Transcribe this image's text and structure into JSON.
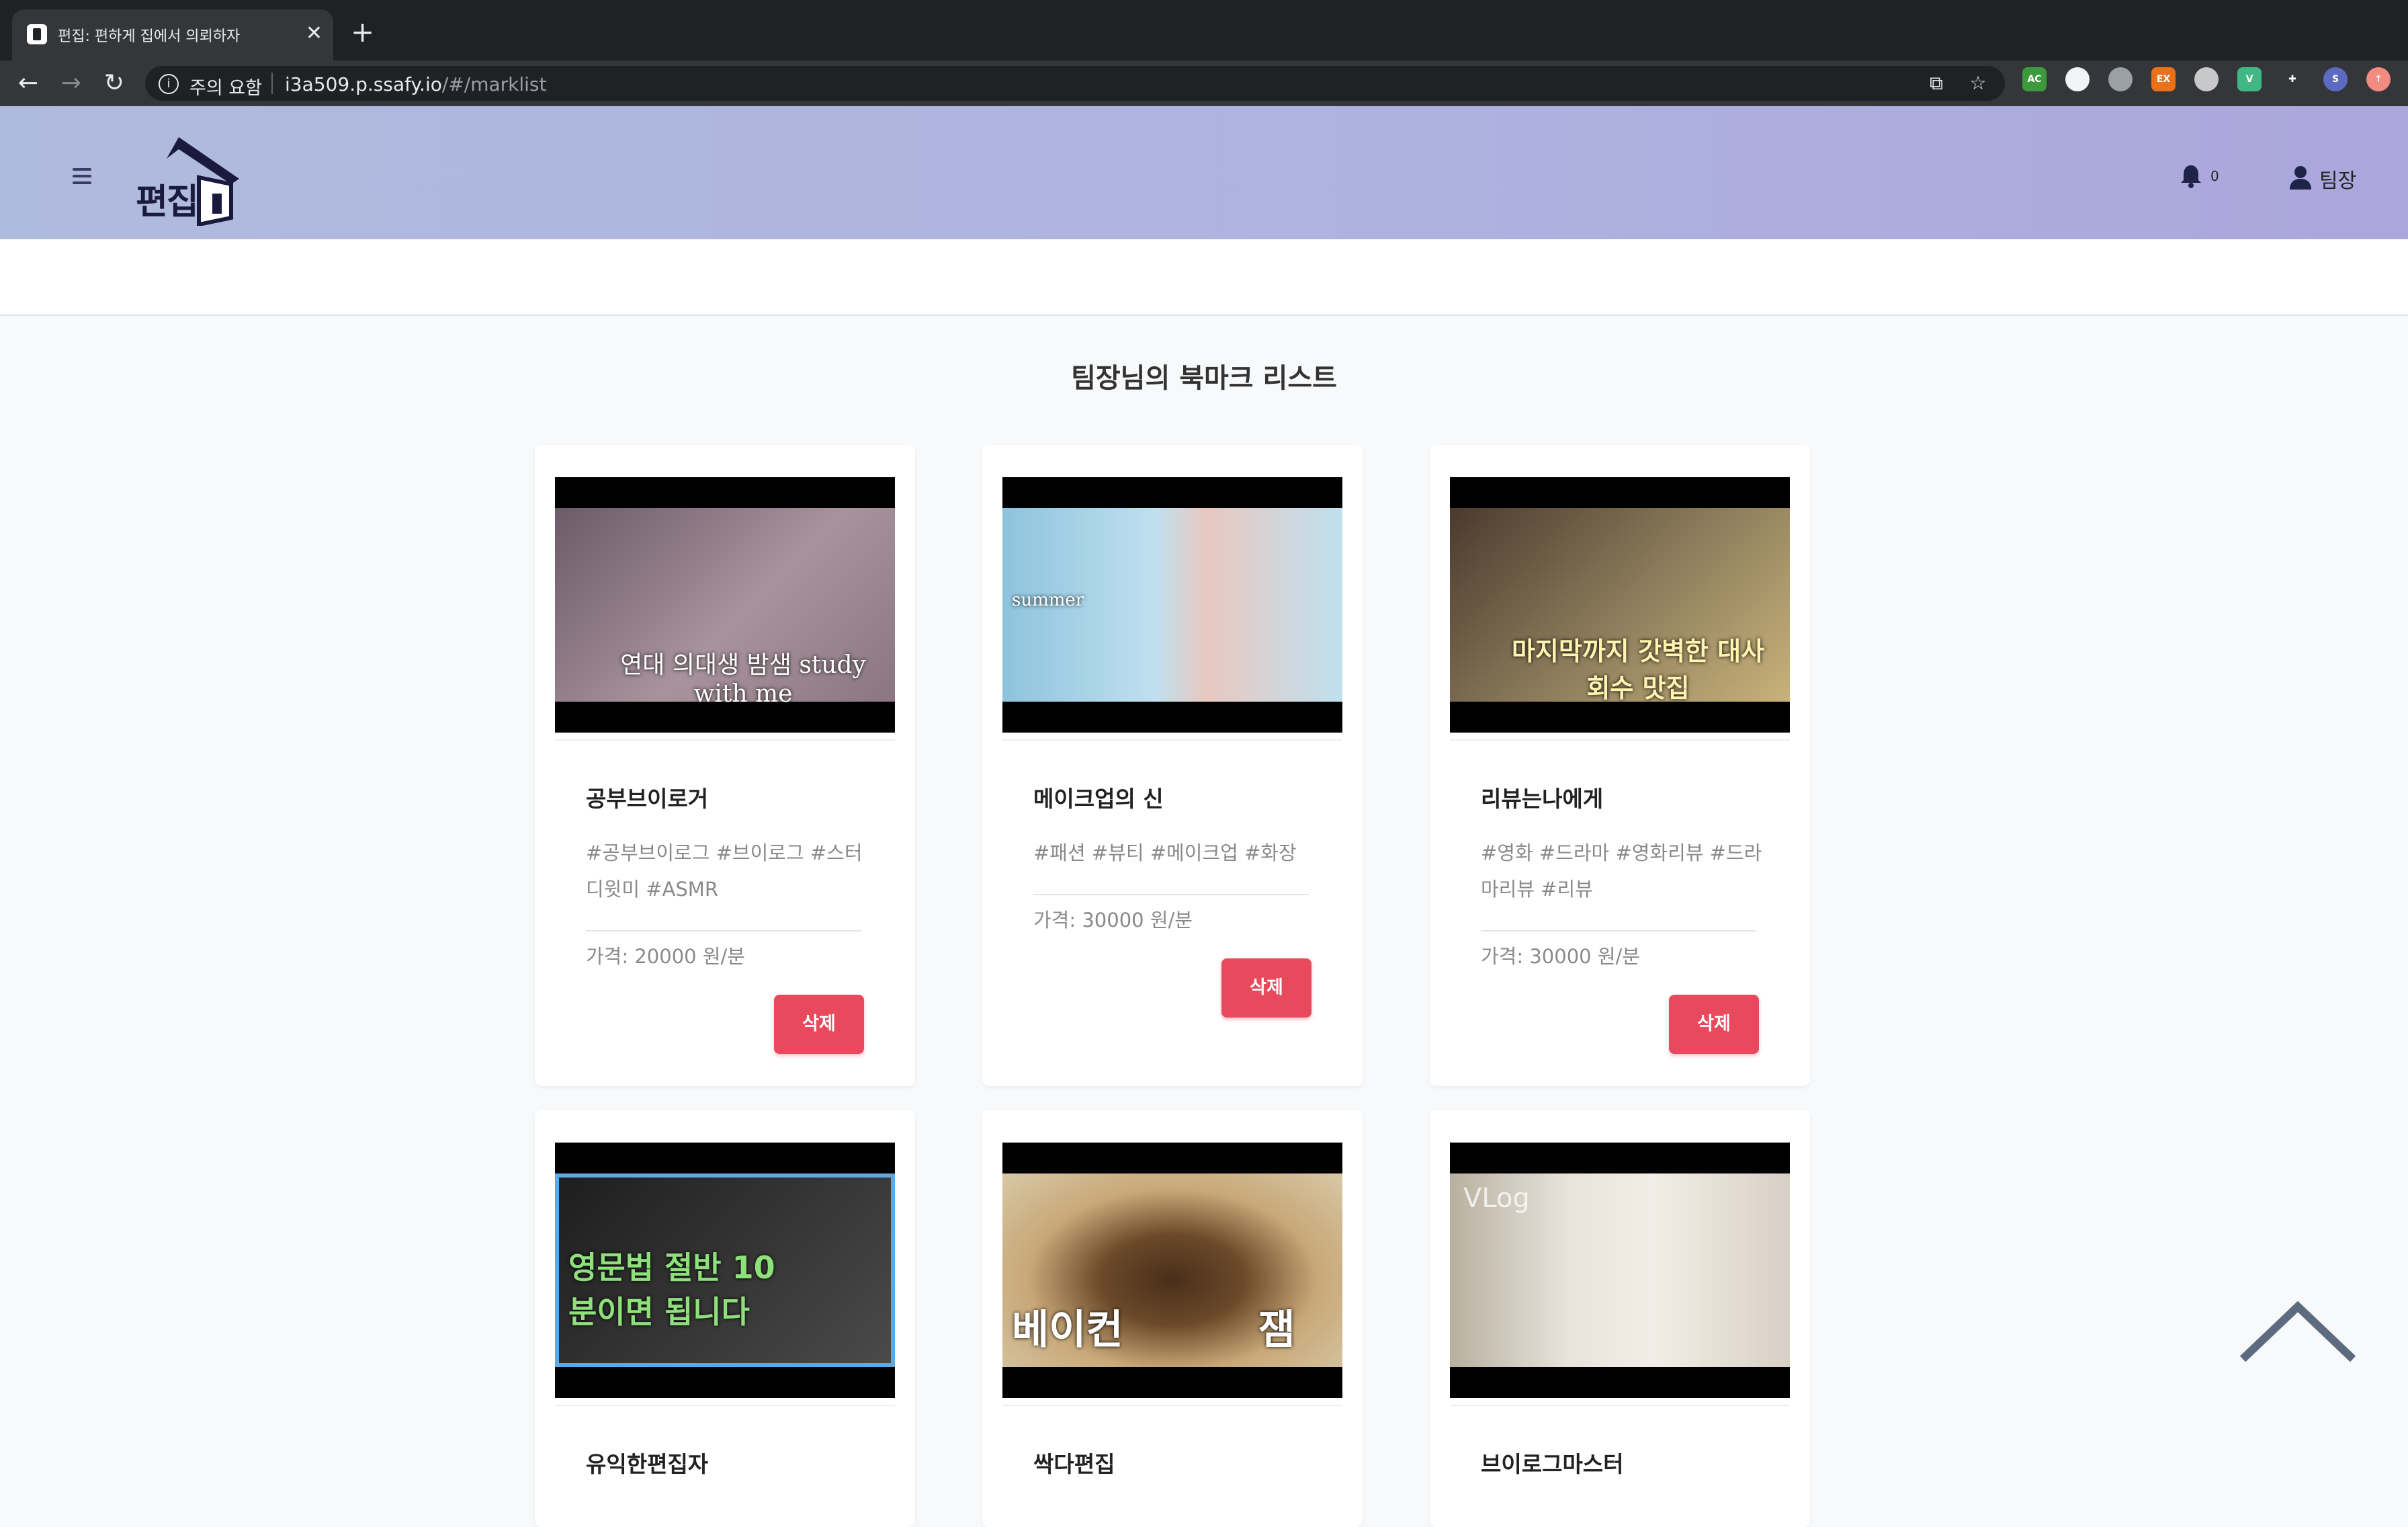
{
  "browser": {
    "tab_title": "편집: 편하게 집에서 의뢰하자",
    "tab_close": "✕",
    "new_tab": "+",
    "back": "←",
    "forward": "→",
    "reload": "↻",
    "security_info": "i",
    "security_warning": "주의 요함",
    "url_host": "i3a509.p.ssafy.io",
    "url_path": "/#/marklist",
    "translate_icon": "⧉",
    "bookmark_star": "☆",
    "extensions": [
      {
        "name": "acrobat-ext-icon",
        "label": "AC",
        "color": "#3c9a3c"
      },
      {
        "name": "circle-ext-icon",
        "label": "",
        "color": "#f1f3f4"
      },
      {
        "name": "grey-ext-icon",
        "label": "",
        "color": "#9aa0a6"
      },
      {
        "name": "ex-ext-icon",
        "label": "EX",
        "color": "#e8711a"
      },
      {
        "name": "record-ext-icon",
        "label": "",
        "color": "#c8c8c8"
      },
      {
        "name": "vue-devtools-icon",
        "label": "V",
        "color": "#41b883"
      },
      {
        "name": "puzzle-extensions-icon",
        "label": "✚",
        "color": "#35363a"
      },
      {
        "name": "profile-avatar-icon",
        "label": "S",
        "color": "#5c6bc0"
      },
      {
        "name": "update-icon",
        "label": "↑",
        "color": "#f28b82"
      }
    ]
  },
  "header": {
    "logo_text": "편집",
    "notification_count": "0",
    "user_name": "팀장"
  },
  "page": {
    "title": "팀장님의 북마크 리스트"
  },
  "cards": [
    {
      "name": "공부브이로거",
      "tags": "#공부브이로그 #브이로그 #스터디윗미 #ASMR",
      "price": "가격: 20000 원/분",
      "delete_label": "삭제",
      "thumb_caption": "연대 의대생 밤샘 study with me",
      "thumb_colors": [
        "#7b6a78",
        "#a8939c"
      ]
    },
    {
      "name": "메이크업의 신",
      "tags": "#패션 #뷰티 #메이크업 #화장",
      "price": "가격: 30000 원/분",
      "delete_label": "삭제",
      "thumb_caption": "summer",
      "thumb_colors": [
        "#8ec3dd",
        "#bfe0ef"
      ]
    },
    {
      "name": "리뷰는나에게",
      "tags": "#영화 #드라마 #영화리뷰 #드라마리뷰 #리뷰",
      "price": "가격: 30000 원/분",
      "delete_label": "삭제",
      "thumb_caption": "마지막까지 갓벽한 대사 회수 맛집",
      "thumb_colors": [
        "#5a4a3a",
        "#c8b27a"
      ]
    },
    {
      "name": "유익한편집자",
      "thumb_caption": "영문법 절반 10분이면 됩니다",
      "thumb_colors": [
        "#2a2a2a",
        "#4a4a4a"
      ]
    },
    {
      "name": "싹다편집",
      "thumb_caption": "베이컨 잼",
      "thumb_colors": [
        "#6b4a2a",
        "#d8c8a8"
      ]
    },
    {
      "name": "브이로그마스터",
      "thumb_caption": "VLog",
      "thumb_colors": [
        "#c8c0b0",
        "#e8e4dc"
      ]
    }
  ]
}
